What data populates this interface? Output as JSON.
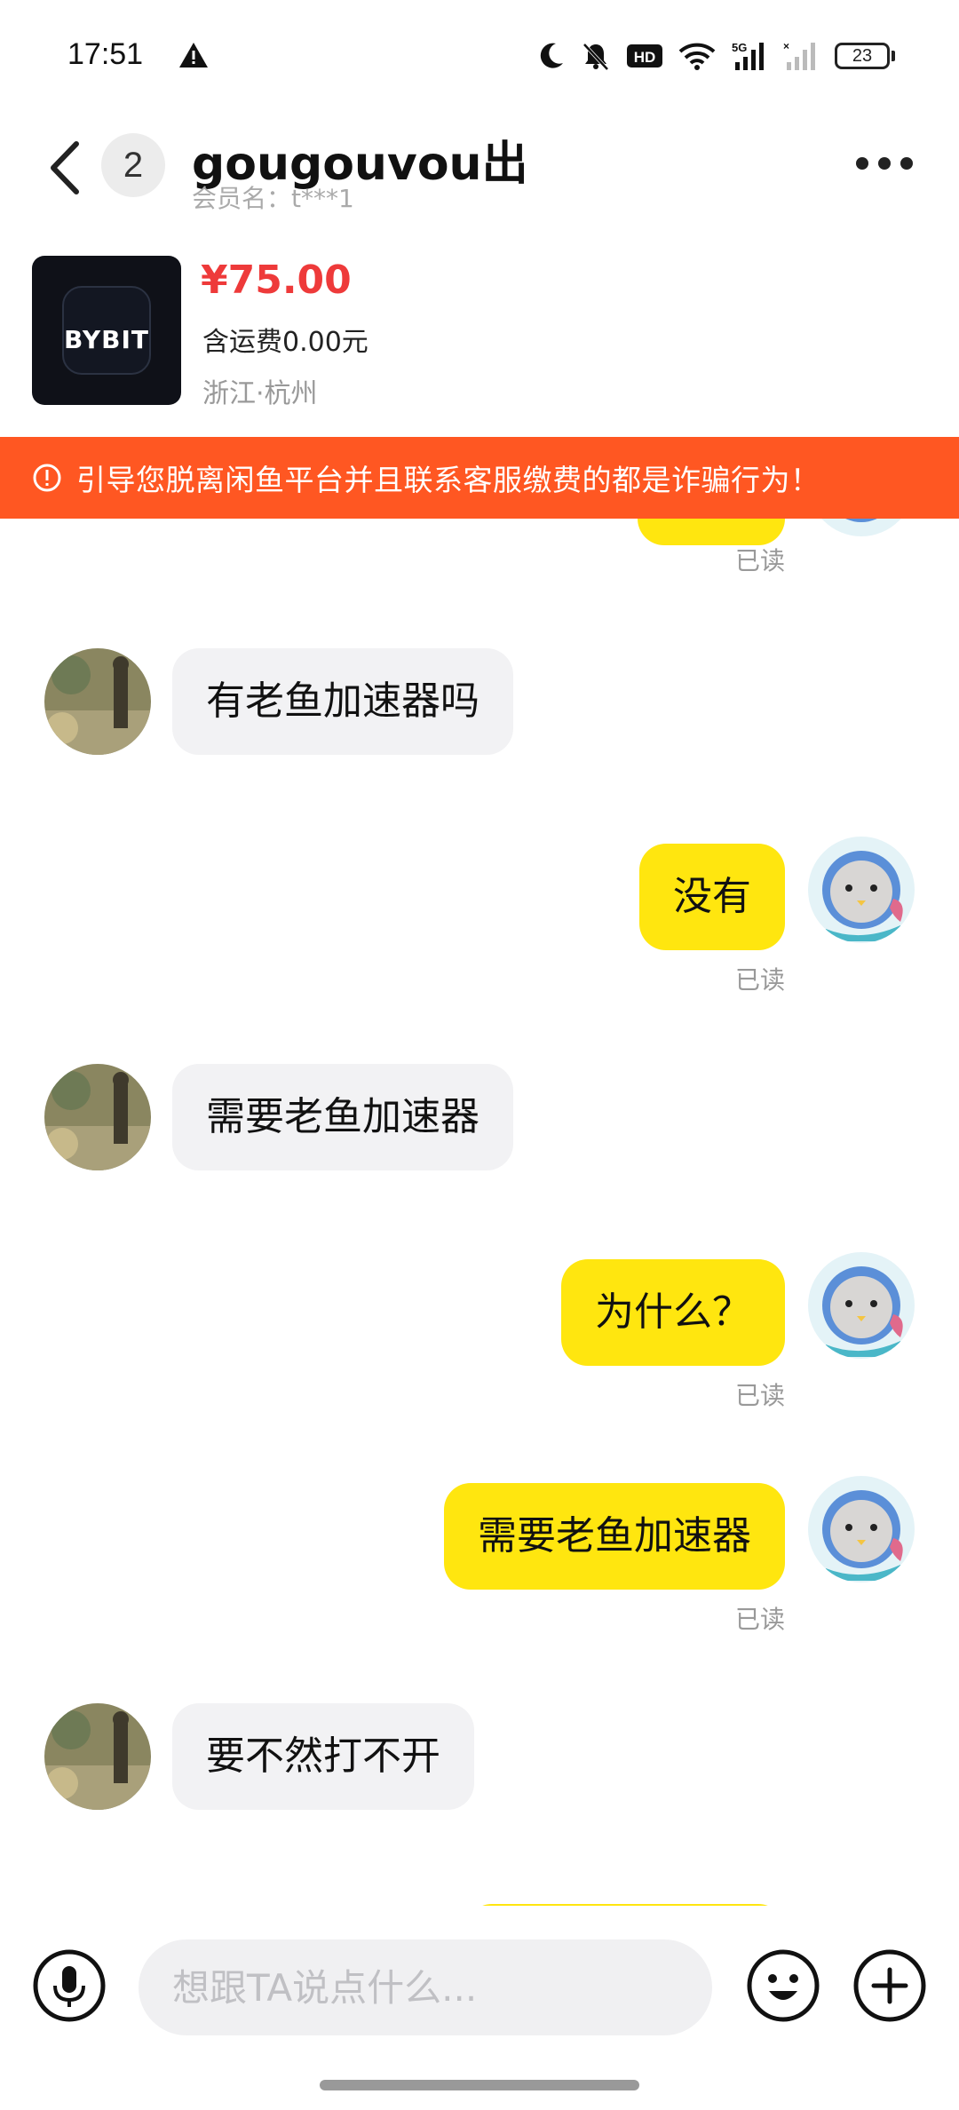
{
  "status_bar": {
    "time": "17:51",
    "icons": [
      "warning-icon",
      "moon-icon",
      "bell-muted-icon",
      "hd-icon",
      "wifi-icon",
      "signal-5g-icon",
      "signal-icon"
    ],
    "battery": "23"
  },
  "header": {
    "unread_count": "2",
    "peer_name": "gougouvou出",
    "member_name": "会员名：t***1"
  },
  "product": {
    "price": "¥75.00",
    "shipping": "含运费0.00元",
    "location": "浙江·杭州",
    "thumb_logo": "BYBIT"
  },
  "warning": {
    "text": "引导您脱离闲鱼平台并且联系客服缴费的都是诈骗行为！"
  },
  "messages": [
    {
      "side": "out",
      "text": "",
      "status": "已读"
    },
    {
      "side": "in",
      "text": "有老鱼加速器吗"
    },
    {
      "side": "out",
      "text": "没有",
      "status": "已读"
    },
    {
      "side": "in",
      "text": "需要老鱼加速器"
    },
    {
      "side": "out",
      "text": "为什么？",
      "status": "已读"
    },
    {
      "side": "out",
      "text": "需要老鱼加速器",
      "status": "已读"
    },
    {
      "side": "in",
      "text": "要不然打不开"
    }
  ],
  "input": {
    "placeholder": "想跟TA说点什么..."
  },
  "colors": {
    "bubble_out": "#ffe60f",
    "bubble_in": "#f2f2f4",
    "warning_bg": "#ff5722",
    "price": "#ee3a3a"
  }
}
